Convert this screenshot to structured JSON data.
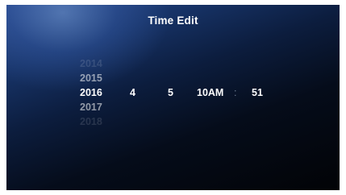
{
  "title": "Time Edit",
  "picker": {
    "years": [
      "2014",
      "2015",
      "2016",
      "2017",
      "2018"
    ],
    "selected_year": "2016",
    "month": "4",
    "day": "5",
    "hour": "10AM",
    "separator": ":",
    "minute": "51"
  }
}
